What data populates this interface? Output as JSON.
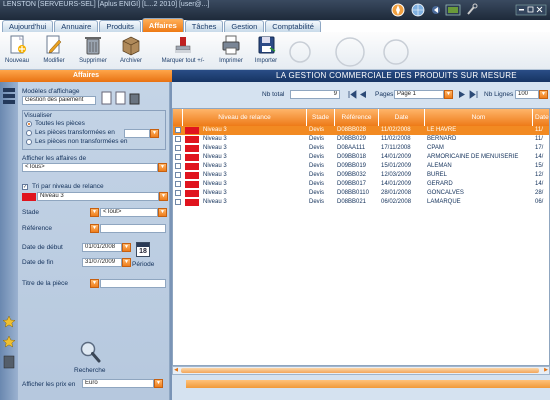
{
  "window": {
    "title": "LENSTON [SERVEURS-SEL] [Aplus ENIGI] [L...2 2010] [user@...]"
  },
  "tabs": [
    {
      "label": "Aujourd'hui",
      "active": false
    },
    {
      "label": "Annuaire",
      "active": false
    },
    {
      "label": "Produits",
      "active": false
    },
    {
      "label": "Affaires",
      "active": true
    },
    {
      "label": "Tâches",
      "active": false
    },
    {
      "label": "Gestion",
      "active": false
    },
    {
      "label": "Comptabilité",
      "active": false
    }
  ],
  "toolbar": {
    "nouveau": "Nouveau",
    "modifier": "Modifier",
    "supprimer": "Supprimer",
    "archiver": "Archiver",
    "marquer": "Marquer tout +/-",
    "imprimer": "Imprimer",
    "importer": "Importer"
  },
  "header": {
    "title": "Affaires",
    "slogan": "LA GESTION COMMERCIALE DES PRODUITS SUR MESURE"
  },
  "left": {
    "modeles_label": "Modèles d'affichage",
    "modeles_value": "Gestion des paiement",
    "visualiser_label": "Visualiser",
    "radio_all": "Toutes les pièces",
    "radio_transformed": "Les pièces transformées en",
    "radio_not_transformed": "Les pièces non transformées en",
    "afficher_label": "Afficher les affaires de",
    "afficher_value": "<Tous>",
    "tri_label": "Tri par niveau de relance",
    "niveau_value": "Niveau 3",
    "stade_label": "Stade",
    "stade_value": "<Tout>",
    "reference_label": "Référence",
    "date_debut_label": "Date de début",
    "date_debut_value": "01/01/2008",
    "date_fin_label": "Date de fin",
    "date_fin_value": "31/07/2009",
    "calendar_day": "18",
    "periode_label": "Période",
    "titre_label": "Titre de la pièce",
    "recherche_label": "Recherche",
    "prix_label": "Afficher les prix en",
    "prix_value": "Euro"
  },
  "nav": {
    "nb_total_label": "Nb total",
    "nb_total_value": "9",
    "pages_label": "Pages",
    "page_value": "Page 1",
    "nb_lignes_label": "Nb Lignes",
    "nb_lignes_value": "100"
  },
  "grid": {
    "columns": [
      "Niveau de relance",
      "Stade",
      "Référence",
      "Date",
      "Nom",
      "Date"
    ],
    "rows": [
      {
        "niveau": "Niveau 3",
        "stade": "Devis",
        "ref": "D08BB028",
        "date": "11/02/2008",
        "nom": "LE HAVRE",
        "date2": "11/",
        "selected": true
      },
      {
        "niveau": "Niveau 3",
        "stade": "Devis",
        "ref": "D08BB029",
        "date": "11/02/2008",
        "nom": "BERNARD",
        "date2": "11/",
        "selected": false
      },
      {
        "niveau": "Niveau 3",
        "stade": "Devis",
        "ref": "D08AA111",
        "date": "17/11/2008",
        "nom": "CPAM",
        "date2": "17/",
        "selected": false
      },
      {
        "niveau": "Niveau 3",
        "stade": "Devis",
        "ref": "D09BB018",
        "date": "14/01/2009",
        "nom": "ARMORICAINE DE MENUISERIE",
        "date2": "14/",
        "selected": false
      },
      {
        "niveau": "Niveau 3",
        "stade": "Devis",
        "ref": "D09BB019",
        "date": "15/01/2009",
        "nom": "ALEMAN",
        "date2": "15/",
        "selected": false
      },
      {
        "niveau": "Niveau 3",
        "stade": "Devis",
        "ref": "D09BB032",
        "date": "12/03/2009",
        "nom": "BUREL",
        "date2": "12/",
        "selected": false
      },
      {
        "niveau": "Niveau 3",
        "stade": "Devis",
        "ref": "D09BB017",
        "date": "14/01/2009",
        "nom": "GERARD",
        "date2": "14/",
        "selected": false
      },
      {
        "niveau": "Niveau 3",
        "stade": "Devis",
        "ref": "D08BB0110",
        "date": "28/01/2008",
        "nom": "GONCALVES",
        "date2": "28/",
        "selected": false
      },
      {
        "niveau": "Niveau 3",
        "stade": "Devis",
        "ref": "D08BB021",
        "date": "06/02/2008",
        "nom": "LAMARQUE",
        "date2": "06/",
        "selected": false
      }
    ]
  },
  "colors": {
    "accent": "#ee7a18",
    "header": "#1f3f73",
    "relance": "#e0141e"
  }
}
